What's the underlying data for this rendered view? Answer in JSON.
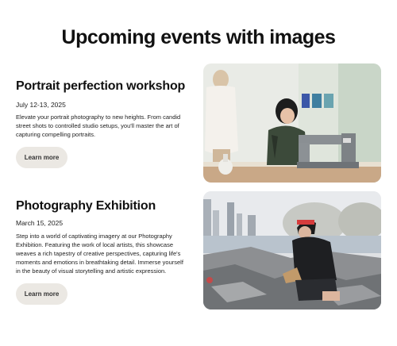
{
  "page": {
    "title": "Upcoming events with images"
  },
  "events": [
    {
      "title": "Portrait perfection workshop",
      "date": "July 12-13, 2025",
      "description_lines": [
        "Elevate your portrait photography to new heights. From candid",
        "street shots to controlled studio setups, you'll master the art of",
        "capturing compelling portraits."
      ],
      "button_label": "Learn more",
      "image_icon": "photo-woman-sewing-machine"
    },
    {
      "title": "Photography Exhibition",
      "date": "March 15, 2025",
      "description_lines": [
        "Step into a world of captivating imagery at our Photography",
        "Exhibition. Featuring the work of local artists, this showcase",
        "weaves a rich tapestry of creative perspectives, capturing life's",
        "moments and emotions in breathtaking detail. Immerse yourself",
        "in the beauty of visual storytelling and artistic expression."
      ],
      "button_label": "Learn more",
      "image_icon": "photo-woman-reading-on-rocks"
    }
  ]
}
